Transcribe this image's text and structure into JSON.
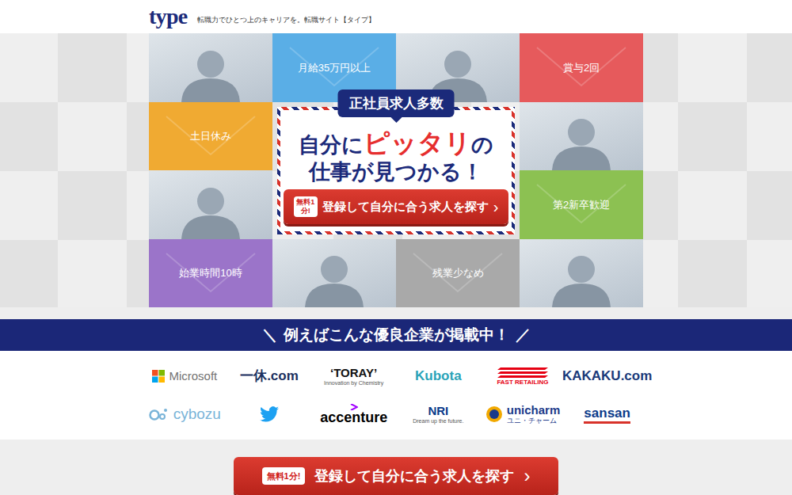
{
  "header": {
    "logo": "type",
    "tagline": "転職力でひとつ上のキャリアを。転職サイト【タイプ】"
  },
  "hero": {
    "tiles": [
      {
        "kind": "photo"
      },
      {
        "kind": "label",
        "text": "月給35万円以上",
        "color": "#5aaee6"
      },
      {
        "kind": "photo"
      },
      {
        "kind": "label",
        "text": "賞与2回",
        "color": "#e65a5c"
      },
      {
        "kind": "label",
        "text": "土日休み",
        "color": "#f0aa32"
      },
      {
        "kind": "photo"
      },
      {
        "kind": "photo"
      },
      {
        "kind": "label",
        "text": "第2新卒歓迎",
        "color": "#8cc152"
      },
      {
        "kind": "label",
        "text": "始業時間10時",
        "color": "#9b74c9"
      },
      {
        "kind": "photo"
      },
      {
        "kind": "label",
        "text": "残業少なめ",
        "color": "#a9a9a9"
      },
      {
        "kind": "photo"
      }
    ],
    "badge": "正社員求人多数",
    "headline": [
      "自分に",
      "ピッタリ",
      "の"
    ],
    "headline_line2": "仕事が見つかる！",
    "cta": {
      "tag": "無料1分!",
      "label": "登録して自分に合う求人を探す",
      "arrow": "›"
    }
  },
  "companies": {
    "title_prefix": "＼",
    "title": "例えばこんな優良企業が掲載中！",
    "title_suffix": "／",
    "logos": [
      {
        "kind": "squares",
        "text": "Microsoft",
        "color": "#737373"
      },
      {
        "kind": "text",
        "text": "一休.com",
        "color": "#1a3060"
      },
      {
        "kind": "sub",
        "text": "‘TORAY’",
        "sub": "Innovation by Chemistry",
        "color": "#111111"
      },
      {
        "kind": "text",
        "text": "Kubota",
        "color": "#2aa3b8"
      },
      {
        "kind": "stripes",
        "text": "FAST RETAILING",
        "color": "#e60012"
      },
      {
        "kind": "text",
        "text": "KAKAKU.com",
        "color": "#1a3a7a"
      },
      {
        "kind": "rings",
        "text": "cybozu",
        "color": "#7ab4d8"
      },
      {
        "kind": "bird",
        "color": "#1da1f2"
      },
      {
        "kind": "accent",
        "text": "accenture",
        "color": "#000000"
      },
      {
        "kind": "sub",
        "text": "NRI",
        "sub": "Dream up the future.",
        "color": "#0a3a8a"
      },
      {
        "kind": "circle-sub",
        "text": "unicharm",
        "sub": "ユニ・チャーム",
        "color": "#1a3a8a"
      },
      {
        "kind": "underline",
        "text": "sansan",
        "color": "#0a3a8a"
      }
    ]
  },
  "bottom_cta": {
    "tag": "無料1分!",
    "label": "登録して自分に合う求人を探す",
    "arrow": "›"
  }
}
